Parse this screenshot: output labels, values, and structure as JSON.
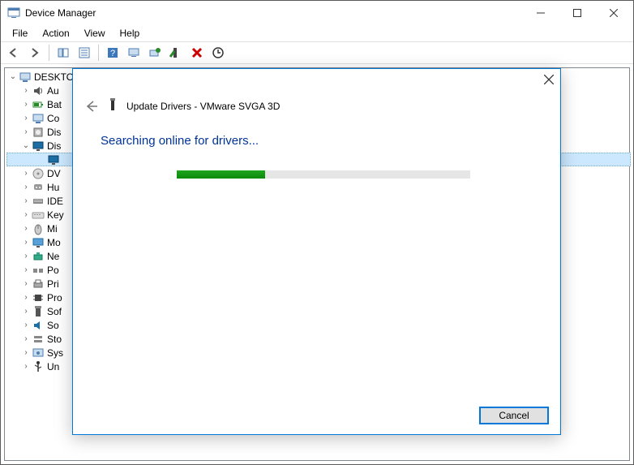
{
  "window": {
    "title": "Device Manager"
  },
  "menu": {
    "items": [
      "File",
      "Action",
      "View",
      "Help"
    ]
  },
  "tree": {
    "root": "DESKTO",
    "items": [
      {
        "label": "Au",
        "expanded": false,
        "depth": 2,
        "icon": "audio"
      },
      {
        "label": "Bat",
        "expanded": false,
        "depth": 2,
        "icon": "battery"
      },
      {
        "label": "Co",
        "expanded": false,
        "depth": 2,
        "icon": "computer"
      },
      {
        "label": "Dis",
        "expanded": false,
        "depth": 2,
        "icon": "disk"
      },
      {
        "label": "Dis",
        "expanded": true,
        "depth": 2,
        "icon": "display"
      },
      {
        "label": "",
        "expanded": null,
        "depth": 3,
        "icon": "display",
        "selected": true
      },
      {
        "label": "DV",
        "expanded": false,
        "depth": 2,
        "icon": "dvd"
      },
      {
        "label": "Hu",
        "expanded": false,
        "depth": 2,
        "icon": "hid"
      },
      {
        "label": "IDE",
        "expanded": false,
        "depth": 2,
        "icon": "ide"
      },
      {
        "label": "Key",
        "expanded": false,
        "depth": 2,
        "icon": "keyboard"
      },
      {
        "label": "Mi",
        "expanded": false,
        "depth": 2,
        "icon": "mouse"
      },
      {
        "label": "Mo",
        "expanded": false,
        "depth": 2,
        "icon": "monitor"
      },
      {
        "label": "Ne",
        "expanded": false,
        "depth": 2,
        "icon": "network"
      },
      {
        "label": "Po",
        "expanded": false,
        "depth": 2,
        "icon": "ports"
      },
      {
        "label": "Pri",
        "expanded": false,
        "depth": 2,
        "icon": "printq"
      },
      {
        "label": "Pro",
        "expanded": false,
        "depth": 2,
        "icon": "processor"
      },
      {
        "label": "Sof",
        "expanded": false,
        "depth": 2,
        "icon": "software"
      },
      {
        "label": "So",
        "expanded": false,
        "depth": 2,
        "icon": "sound"
      },
      {
        "label": "Sto",
        "expanded": false,
        "depth": 2,
        "icon": "storage"
      },
      {
        "label": "Sys",
        "expanded": false,
        "depth": 2,
        "icon": "system"
      },
      {
        "label": "Un",
        "expanded": false,
        "depth": 2,
        "icon": "usb"
      }
    ]
  },
  "dialog": {
    "title": "Update Drivers - VMware SVGA 3D",
    "headline": "Searching online for drivers...",
    "progress_percent": 30,
    "cancel_label": "Cancel"
  }
}
